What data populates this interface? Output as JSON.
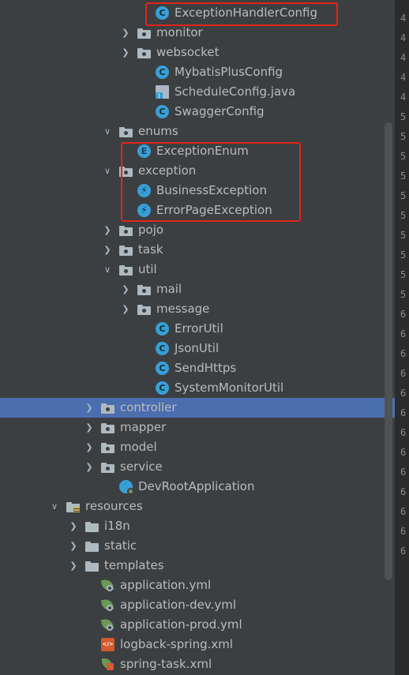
{
  "tree": [
    {
      "label": "ExceptionHandlerConfig",
      "icon": "class",
      "depth": 5,
      "arrow": "none"
    },
    {
      "label": "monitor",
      "icon": "package",
      "depth": 4,
      "arrow": "collapsed"
    },
    {
      "label": "websocket",
      "icon": "package",
      "depth": 4,
      "arrow": "collapsed"
    },
    {
      "label": "MybatisPlusConfig",
      "icon": "class",
      "depth": 5,
      "arrow": "none"
    },
    {
      "label": "ScheduleConfig.java",
      "icon": "java-file",
      "depth": 5,
      "arrow": "none"
    },
    {
      "label": "SwaggerConfig",
      "icon": "class",
      "depth": 5,
      "arrow": "none"
    },
    {
      "label": "enums",
      "icon": "package",
      "depth": 3,
      "arrow": "expanded"
    },
    {
      "label": "ExceptionEnum",
      "icon": "enum",
      "depth": 4,
      "arrow": "none"
    },
    {
      "label": "exception",
      "icon": "package",
      "depth": 3,
      "arrow": "expanded"
    },
    {
      "label": "BusinessException",
      "icon": "exception",
      "depth": 4,
      "arrow": "none"
    },
    {
      "label": "ErrorPageException",
      "icon": "exception",
      "depth": 4,
      "arrow": "none"
    },
    {
      "label": "pojo",
      "icon": "package",
      "depth": 3,
      "arrow": "collapsed"
    },
    {
      "label": "task",
      "icon": "package",
      "depth": 3,
      "arrow": "collapsed"
    },
    {
      "label": "util",
      "icon": "package",
      "depth": 3,
      "arrow": "expanded"
    },
    {
      "label": "mail",
      "icon": "package",
      "depth": 4,
      "arrow": "collapsed"
    },
    {
      "label": "message",
      "icon": "package",
      "depth": 4,
      "arrow": "collapsed"
    },
    {
      "label": "ErrorUtil",
      "icon": "class",
      "depth": 5,
      "arrow": "none"
    },
    {
      "label": "JsonUtil",
      "icon": "class",
      "depth": 5,
      "arrow": "none"
    },
    {
      "label": "SendHttps",
      "icon": "class",
      "depth": 5,
      "arrow": "none"
    },
    {
      "label": "SystemMonitorUtil",
      "icon": "class",
      "depth": 5,
      "arrow": "none"
    },
    {
      "label": "controller",
      "icon": "package",
      "depth": 2,
      "arrow": "collapsed",
      "selected": true
    },
    {
      "label": "mapper",
      "icon": "package",
      "depth": 2,
      "arrow": "collapsed"
    },
    {
      "label": "model",
      "icon": "package",
      "depth": 2,
      "arrow": "collapsed"
    },
    {
      "label": "service",
      "icon": "package",
      "depth": 2,
      "arrow": "collapsed"
    },
    {
      "label": "DevRootApplication",
      "icon": "app",
      "depth": 3,
      "arrow": "none"
    },
    {
      "label": "resources",
      "icon": "resources",
      "depth": 0,
      "arrow": "expanded"
    },
    {
      "label": "i18n",
      "icon": "folder",
      "depth": 1,
      "arrow": "collapsed"
    },
    {
      "label": "static",
      "icon": "folder",
      "depth": 1,
      "arrow": "collapsed"
    },
    {
      "label": "templates",
      "icon": "folder",
      "depth": 1,
      "arrow": "collapsed"
    },
    {
      "label": "application.yml",
      "icon": "yml",
      "depth": 2,
      "arrow": "none"
    },
    {
      "label": "application-dev.yml",
      "icon": "yml",
      "depth": 2,
      "arrow": "none"
    },
    {
      "label": "application-prod.yml",
      "icon": "yml",
      "depth": 2,
      "arrow": "none"
    },
    {
      "label": "logback-spring.xml",
      "icon": "xml",
      "depth": 2,
      "arrow": "none"
    },
    {
      "label": "spring-task.xml",
      "icon": "xml-spring",
      "depth": 2,
      "arrow": "none"
    }
  ],
  "gutter_numbers": [
    "4",
    "4",
    "4",
    "4",
    "4",
    "5",
    "5",
    "5",
    "5",
    "5",
    "5",
    "5",
    "5",
    "5",
    "5",
    "6",
    "6",
    "6",
    "6",
    "6",
    "6",
    "6",
    "6",
    "6",
    "6",
    "6",
    "6",
    "6"
  ],
  "colors": {
    "highlight": "#e0251b",
    "selected": "#4b6eaf",
    "background": "#3c3f41"
  }
}
